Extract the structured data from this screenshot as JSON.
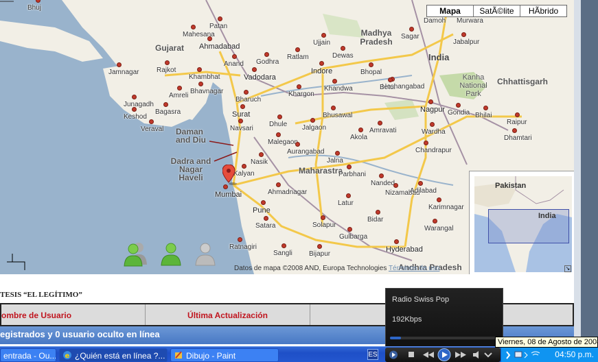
{
  "map": {
    "type_buttons": [
      "Mapa",
      "SatÃ©lite",
      "HÃ­brido"
    ],
    "regions": [
      {
        "text": "Gujarat",
        "cls": "region bold"
      },
      {
        "text": "Madhya Pradesh",
        "cls": "region bold"
      },
      {
        "text": "India",
        "cls": "region bold"
      },
      {
        "text": "Maharastra",
        "cls": "region bold"
      },
      {
        "text": "Chhattisgarh",
        "cls": "region bold"
      },
      {
        "text": "Kanha National Park",
        "cls": "region"
      },
      {
        "text": "Daman and Diu",
        "cls": "region bold"
      },
      {
        "text": "Dadra and Nagar Haveli",
        "cls": "region bold"
      },
      {
        "text": "Andhra Pradesh",
        "cls": "region bold"
      }
    ],
    "cities": [
      "Bhuj",
      "Mahesana",
      "Patan",
      "Ahmadabad",
      "Anand",
      "Vadodara",
      "Godhra",
      "Jamnagar",
      "Rajkot",
      "Khambhat",
      "Bhavnagar",
      "Amreli",
      "Junagadh",
      "Bagasra",
      "Keshod",
      "Veraval",
      "Surat",
      "Bharuch",
      "Navsari",
      "Dhule",
      "Jalgaon",
      "Malegaon",
      "Nasik",
      "Kalyan",
      "Mumbai",
      "Pune",
      "Satara",
      "Ratnagiri",
      "Sangli",
      "Bijapur",
      "Gulbarga",
      "Bidar",
      "Solapur",
      "Latur",
      "Parbhani",
      "Nanded",
      "Aurangabad",
      "Jalna",
      "Ahmadnagar",
      "Akola",
      "Amravati",
      "Bhusawal",
      "Khandwa",
      "Khargon",
      "Indore",
      "Ratlam",
      "Ujjain",
      "Dewas",
      "Bhopal",
      "Hoshangabad",
      "Betul",
      "Sagar",
      "Damoh",
      "Murwara",
      "Jabalpur",
      "Nagpur",
      "Wardha",
      "Chandrapur",
      "Gondia",
      "Bhilai",
      "Raipur",
      "Dhamtari",
      "Nizamabad",
      "Karimnagar",
      "Warangal",
      "Hyderabad",
      "Adilabad"
    ],
    "overview_labels": [
      "Pakistan",
      "India"
    ],
    "attribution": "Datos de mapa ©2008 AND, Europa Technologies",
    "terms": "Términos de uso"
  },
  "forum": {
    "title": "TESIS “EL LEGÍTIMO”",
    "col_user": "ombre de Usuario",
    "col_update": "Última Actualización",
    "online_text": "egistrados y 0 usuario oculto en línea"
  },
  "radio": {
    "station": "Radio Swiss Pop",
    "bitrate": "192Kbps",
    "progress_pct": 10
  },
  "tooltip": "Viernes, 08 de Agosto de 2008",
  "taskbar": {
    "tasks": [
      "entrada - Ou...",
      "¿Quién está en línea ?...",
      "Dibujo - Paint"
    ],
    "language": "ES",
    "clock": "04:50 p.m."
  }
}
